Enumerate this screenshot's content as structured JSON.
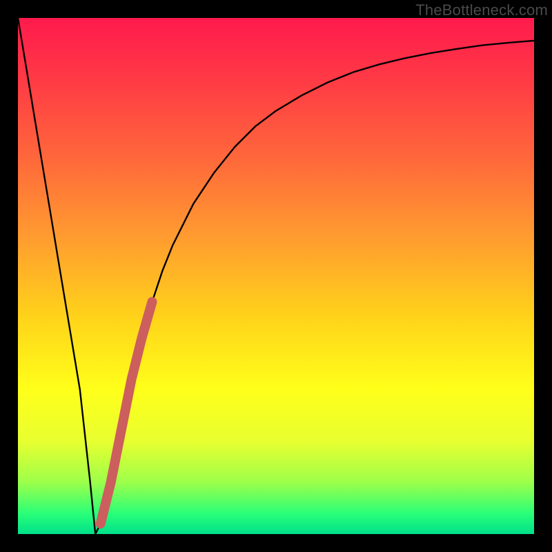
{
  "watermark": "TheBottleneck.com",
  "chart_data": {
    "type": "line",
    "title": "",
    "xlabel": "",
    "ylabel": "",
    "xlim": [
      0,
      100
    ],
    "ylim": [
      0,
      100
    ],
    "series": [
      {
        "name": "bottleneck-curve",
        "x": [
          0,
          2,
          4,
          6,
          8,
          10,
          12,
          14,
          15,
          16,
          18,
          20,
          22,
          24,
          26,
          28,
          30,
          34,
          38,
          42,
          46,
          50,
          55,
          60,
          65,
          70,
          75,
          80,
          85,
          90,
          95,
          100
        ],
        "y": [
          100,
          88,
          76,
          64,
          52,
          40,
          28,
          10,
          0,
          2,
          10,
          20,
          30,
          38,
          45,
          51,
          56,
          64,
          70,
          75,
          79,
          82,
          85,
          87.5,
          89.5,
          91,
          92.2,
          93.2,
          94,
          94.7,
          95.2,
          95.6
        ]
      }
    ],
    "highlight": {
      "name": "highlight-band",
      "color": "#cc5e5e",
      "x": [
        16,
        18,
        20,
        22,
        24,
        26
      ],
      "y": [
        2,
        10,
        20,
        30,
        38,
        45
      ]
    },
    "gradient_stops": [
      {
        "pos": 0,
        "color": "#ff1a4d"
      },
      {
        "pos": 12,
        "color": "#ff3a45"
      },
      {
        "pos": 28,
        "color": "#ff6a3a"
      },
      {
        "pos": 42,
        "color": "#ff9a30"
      },
      {
        "pos": 58,
        "color": "#ffd31a"
      },
      {
        "pos": 72,
        "color": "#ffff1a"
      },
      {
        "pos": 82,
        "color": "#e8ff30"
      },
      {
        "pos": 90,
        "color": "#9cff4a"
      },
      {
        "pos": 96,
        "color": "#2aff78"
      },
      {
        "pos": 100,
        "color": "#00e08a"
      }
    ]
  }
}
